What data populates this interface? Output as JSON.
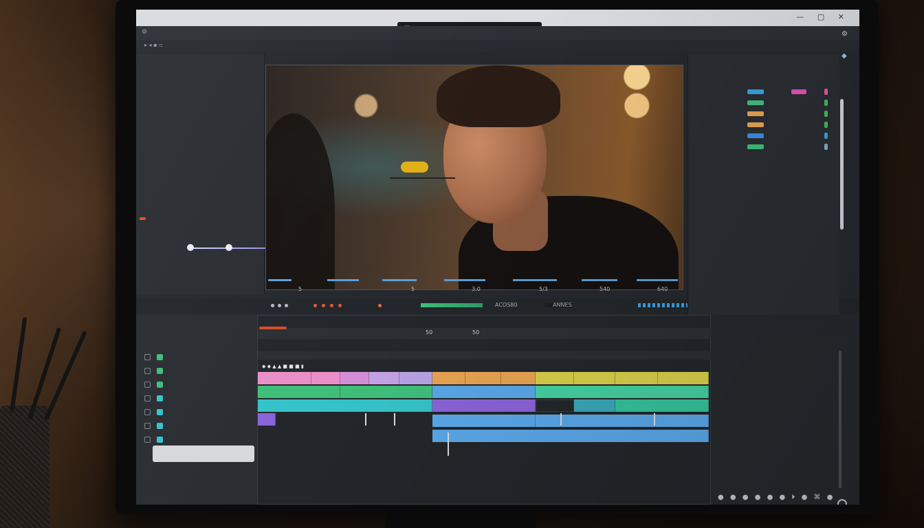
{
  "toolbar": {
    "file_field_value": "10"
  },
  "viewer": {
    "timecodes": [
      "5",
      "5",
      "5/3",
      "540",
      "3:0",
      "640"
    ]
  },
  "transport": {
    "label_1": "ACOS80",
    "label_2": "ANNES"
  },
  "timeline": {
    "ruler_labels": [
      "50",
      "50"
    ]
  },
  "colors": {
    "pink": "#e98fc8",
    "green": "#3fbf7a",
    "cyan": "#35c3c9",
    "purple": "#8a63d8",
    "orange": "#e8a452",
    "yellow": "#d7d04a",
    "blue": "#5aa7e8",
    "lavender": "#b8a3e6",
    "red_marker": "#d84a2a"
  },
  "icons": [
    "search-icon",
    "gear-icon",
    "play-icon",
    "settings-icon",
    "scroll-icon"
  ]
}
